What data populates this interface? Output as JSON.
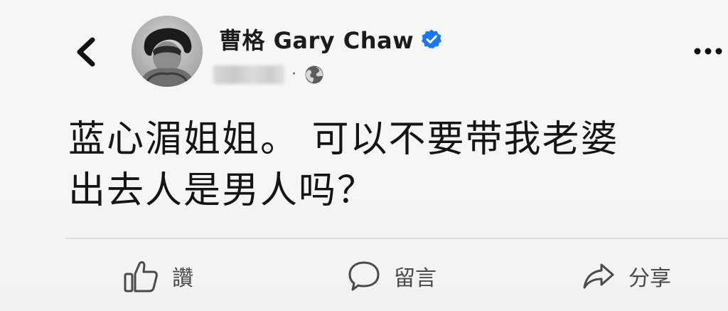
{
  "header": {
    "author_name": "曹格 Gary Chaw",
    "separator": "·"
  },
  "post": {
    "lines": [
      "蓝心湄姐姐。 可以不要带我老婆",
      "出去人是男人吗？"
    ]
  },
  "actions": {
    "like_label": "讚",
    "comment_label": "留言",
    "share_label": "分享"
  },
  "colors": {
    "verified_blue": "#1877f2",
    "text_dark": "#151515",
    "action_gray": "#4a4a4a"
  },
  "icons": {
    "back": "chevron-left-icon",
    "verified": "verified-badge-icon",
    "privacy": "globe-icon",
    "more": "more-dots-icon",
    "like": "thumbs-up-icon",
    "comment": "comment-bubble-icon",
    "share": "share-arrow-icon"
  }
}
